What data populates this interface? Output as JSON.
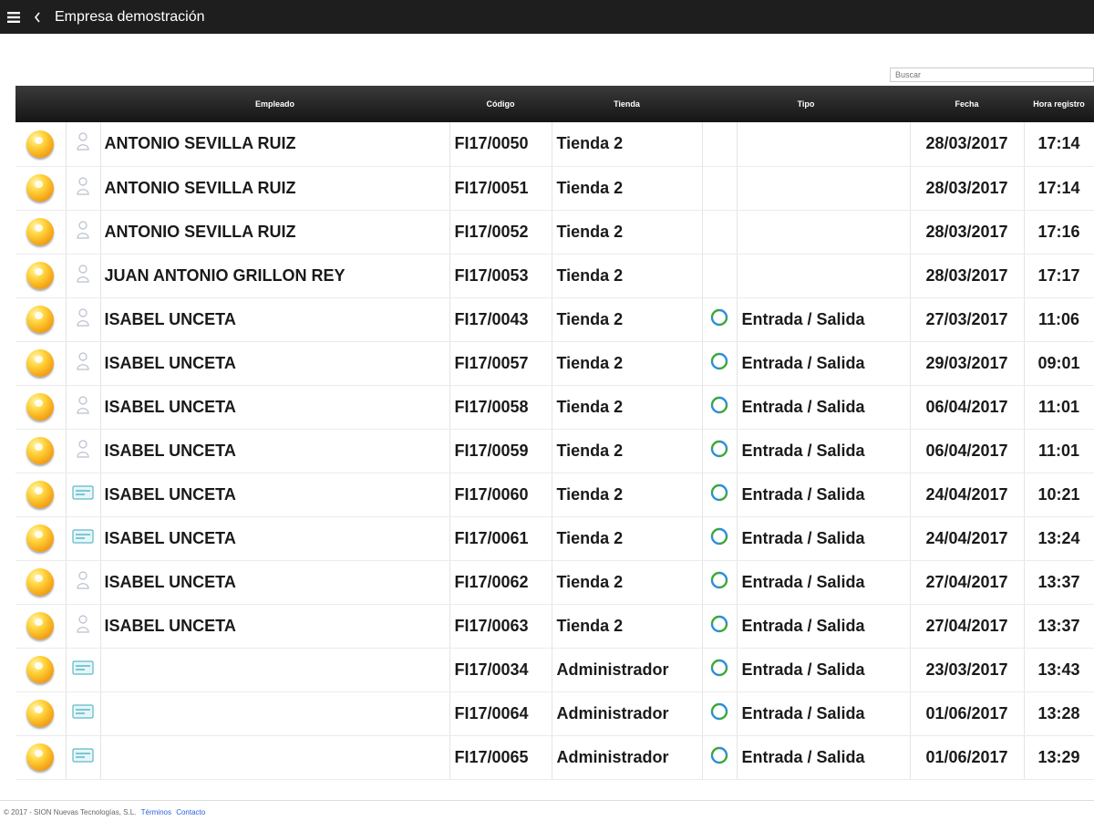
{
  "app": {
    "title": "Empresa demostración",
    "menu_icon": "hamburger-menu-icon",
    "back_icon": "chevron-left-icon"
  },
  "search": {
    "placeholder": "Buscar",
    "value": ""
  },
  "table": {
    "headers": {
      "empleado": "Empleado",
      "codigo": "Código",
      "tienda": "Tienda",
      "tipo": "Tipo",
      "fecha": "Fecha",
      "hora": "Hora registro"
    },
    "rows": [
      {
        "empleado": "ANTONIO SEVILLA RUIZ",
        "codigo": "FI17/0050",
        "tienda": "Tienda 2",
        "tipo": "",
        "fecha": "28/03/2017",
        "hora": "17:14",
        "icon": "person-icon"
      },
      {
        "empleado": "ANTONIO SEVILLA RUIZ",
        "codigo": "FI17/0051",
        "tienda": "Tienda 2",
        "tipo": "",
        "fecha": "28/03/2017",
        "hora": "17:14",
        "icon": "person-icon"
      },
      {
        "empleado": "ANTONIO SEVILLA RUIZ",
        "codigo": "FI17/0052",
        "tienda": "Tienda 2",
        "tipo": "",
        "fecha": "28/03/2017",
        "hora": "17:16",
        "icon": "person-icon"
      },
      {
        "empleado": "JUAN ANTONIO GRILLON REY",
        "codigo": "FI17/0053",
        "tienda": "Tienda 2",
        "tipo": "",
        "fecha": "28/03/2017",
        "hora": "17:17",
        "icon": "person-icon"
      },
      {
        "empleado": "ISABEL UNCETA",
        "codigo": "FI17/0043",
        "tienda": "Tienda 2",
        "tipo": "Entrada / Salida",
        "fecha": "27/03/2017",
        "hora": "11:06",
        "icon": "person-icon"
      },
      {
        "empleado": "ISABEL UNCETA",
        "codigo": "FI17/0057",
        "tienda": "Tienda 2",
        "tipo": "Entrada / Salida",
        "fecha": "29/03/2017",
        "hora": "09:01",
        "icon": "person-icon"
      },
      {
        "empleado": "ISABEL UNCETA",
        "codigo": "FI17/0058",
        "tienda": "Tienda 2",
        "tipo": "Entrada / Salida",
        "fecha": "06/04/2017",
        "hora": "11:01",
        "icon": "person-icon"
      },
      {
        "empleado": "ISABEL UNCETA",
        "codigo": "FI17/0059",
        "tienda": "Tienda 2",
        "tipo": "Entrada / Salida",
        "fecha": "06/04/2017",
        "hora": "11:01",
        "icon": "person-icon"
      },
      {
        "empleado": "ISABEL UNCETA",
        "codigo": "FI17/0060",
        "tienda": "Tienda 2",
        "tipo": "Entrada / Salida",
        "fecha": "24/04/2017",
        "hora": "10:21",
        "icon": "card-icon"
      },
      {
        "empleado": "ISABEL UNCETA",
        "codigo": "FI17/0061",
        "tienda": "Tienda 2",
        "tipo": "Entrada / Salida",
        "fecha": "24/04/2017",
        "hora": "13:24",
        "icon": "card-icon"
      },
      {
        "empleado": "ISABEL UNCETA",
        "codigo": "FI17/0062",
        "tienda": "Tienda 2",
        "tipo": "Entrada / Salida",
        "fecha": "27/04/2017",
        "hora": "13:37",
        "icon": "person-icon"
      },
      {
        "empleado": "ISABEL UNCETA",
        "codigo": "FI17/0063",
        "tienda": "Tienda 2",
        "tipo": "Entrada / Salida",
        "fecha": "27/04/2017",
        "hora": "13:37",
        "icon": "person-icon"
      },
      {
        "empleado": "",
        "codigo": "FI17/0034",
        "tienda": "Administrador",
        "tipo": "Entrada / Salida",
        "fecha": "23/03/2017",
        "hora": "13:43",
        "icon": "card-icon"
      },
      {
        "empleado": "",
        "codigo": "FI17/0064",
        "tienda": "Administrador",
        "tipo": "Entrada / Salida",
        "fecha": "01/06/2017",
        "hora": "13:28",
        "icon": "card-icon"
      },
      {
        "empleado": "",
        "codigo": "FI17/0065",
        "tienda": "Administrador",
        "tipo": "Entrada / Salida",
        "fecha": "01/06/2017",
        "hora": "13:29",
        "icon": "card-icon"
      }
    ]
  },
  "footer": {
    "copyright": "© 2017 - SION Nuevas Tecnologías, S.L.",
    "terms": "Términos",
    "contact": "Contacto"
  }
}
